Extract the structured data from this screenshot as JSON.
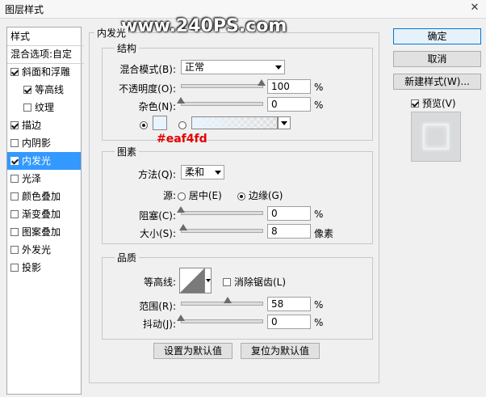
{
  "window": {
    "title": "图层样式",
    "close_glyph": "✕"
  },
  "watermark": "www.240PS.com",
  "annotation": "#eaf4fd",
  "style_list": {
    "header": "样式",
    "blend": "混合选项:自定",
    "items": [
      {
        "label": "斜面和浮雕",
        "checked": true
      },
      {
        "label": "等高线",
        "checked": true
      },
      {
        "label": "纹理",
        "checked": false
      },
      {
        "label": "描边",
        "checked": true
      },
      {
        "label": "内阴影",
        "checked": false
      },
      {
        "label": "内发光",
        "checked": true,
        "active": true
      },
      {
        "label": "光泽",
        "checked": false
      },
      {
        "label": "颜色叠加",
        "checked": false
      },
      {
        "label": "渐变叠加",
        "checked": false
      },
      {
        "label": "图案叠加",
        "checked": false
      },
      {
        "label": "外发光",
        "checked": false
      },
      {
        "label": "投影",
        "checked": false
      }
    ]
  },
  "panel": {
    "title": "内发光",
    "structure": {
      "legend": "结构",
      "blend_mode_label": "混合模式(B):",
      "blend_mode_value": "正常",
      "opacity_label": "不透明度(O):",
      "opacity_value": "100",
      "opacity_unit": "%",
      "noise_label": "杂色(N):",
      "noise_value": "0",
      "noise_unit": "%",
      "glow_color": "#eaf4fd"
    },
    "elements": {
      "legend": "图素",
      "technique_label": "方法(Q):",
      "technique_value": "柔和",
      "source_label": "源:",
      "source_center": "居中(E)",
      "source_edge": "边缘(G)",
      "choke_label": "阻塞(C):",
      "choke_value": "0",
      "choke_unit": "%",
      "size_label": "大小(S):",
      "size_value": "8",
      "size_unit": "像素"
    },
    "quality": {
      "legend": "品质",
      "contour_label": "等高线:",
      "anti_alias_label": "消除锯齿(L)",
      "range_label": "范围(R):",
      "range_value": "58",
      "range_unit": "%",
      "jitter_label": "抖动(J):",
      "jitter_value": "0",
      "jitter_unit": "%"
    },
    "make_default": "设置为默认值",
    "reset_default": "复位为默认值"
  },
  "right": {
    "ok": "确定",
    "cancel": "取消",
    "new_style": "新建样式(W)...",
    "preview_label": "预览(V)",
    "preview_checked": true
  }
}
